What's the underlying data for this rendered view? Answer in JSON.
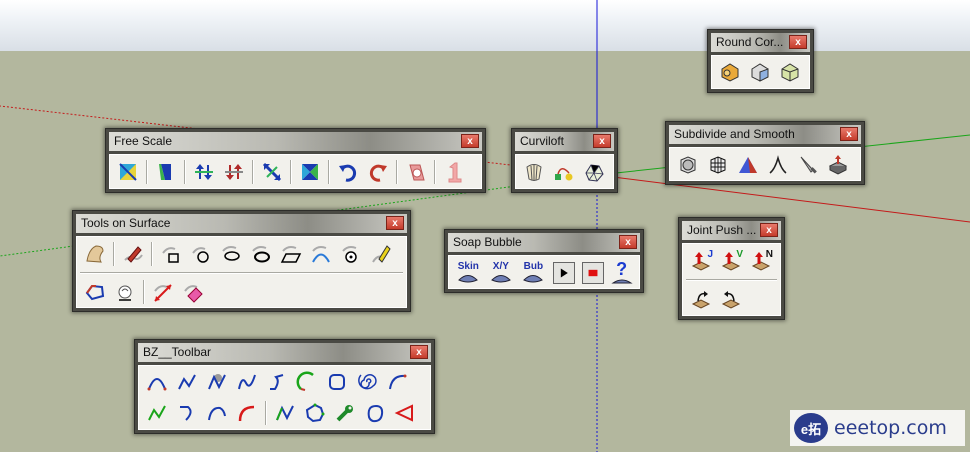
{
  "scene": {
    "sky_color": "#eef2f6",
    "ground_color": "#b3b79e",
    "axis_colors": {
      "blue": "#1515d8",
      "green": "#1aa51a",
      "red": "#c41a1a"
    }
  },
  "toolbars": {
    "round_corner": {
      "title": "Round Cor...",
      "close": "x",
      "icons": [
        "round-corner-icon",
        "sharp-corner-icon",
        "bevel-icon"
      ]
    },
    "free_scale": {
      "title": "Free Scale",
      "close": "x",
      "icons": [
        "box-scale-icon",
        "planar-scale-icon",
        "vertical-scale-up-icon",
        "vertical-scale-down-icon",
        "diagonal-scale-icon",
        "twist-icon",
        "rotate-cw-icon",
        "rotate-ccw-icon",
        "shear-icon",
        "scale-one-icon"
      ]
    },
    "curviloft": {
      "title": "Curviloft",
      "close": "x",
      "icons": [
        "loft-by-spline-icon",
        "skin-contours-icon",
        "loft-along-path-icon"
      ]
    },
    "subdivide": {
      "title": "Subdivide and Smooth",
      "close": "x",
      "icons": [
        "subdivide-cube-icon",
        "smooth-mesh-icon",
        "crease-icon",
        "crease-edge-icon",
        "knife-icon",
        "box-mesh-icon"
      ]
    },
    "tools_on_surface": {
      "title": "Tools on Surface",
      "close": "x",
      "row1": [
        "surface-icon",
        "surface-pencil-icon",
        "surface-rectangle-icon",
        "surface-circle-icon",
        "surface-polygon-icon",
        "surface-ellipse-icon",
        "surface-parallelogram-icon",
        "surface-arc-icon",
        "surface-text-icon",
        "surface-erase-icon"
      ],
      "row2": [
        "surface-offset-icon",
        "surface-protractor-icon",
        "surface-line-icon",
        "surface-eraser-icon"
      ]
    },
    "soap_bubble": {
      "title": "Soap Bubble",
      "close": "x",
      "labels": {
        "skin": "Skin",
        "xy": "X/Y",
        "bub": "Bub",
        "help": "?"
      }
    },
    "joint_push": {
      "title": "Joint Push ...",
      "close": "x",
      "labels": {
        "joint": "J",
        "vector": "V",
        "normal": "N"
      }
    },
    "bz_toolbar": {
      "title": "BZ__Toolbar",
      "close": "x",
      "row1": [
        "bezier-classic-icon",
        "polyline-icon",
        "spline-icon",
        "fspline-icon",
        "catmull-icon",
        "circle-arc-icon",
        "rounded-square-icon",
        "spiral-icon",
        "arc-icon"
      ],
      "row2": [
        "divider-curve-icon",
        "curve-hook-icon",
        "curve-s-icon",
        "red-arc-icon",
        "zigzag-icon",
        "polygon-icon",
        "wrench-icon",
        "blob-icon",
        "triangle-icon"
      ]
    }
  },
  "watermark": {
    "brand": "eeetop.com",
    "logo_text": "e拓"
  }
}
